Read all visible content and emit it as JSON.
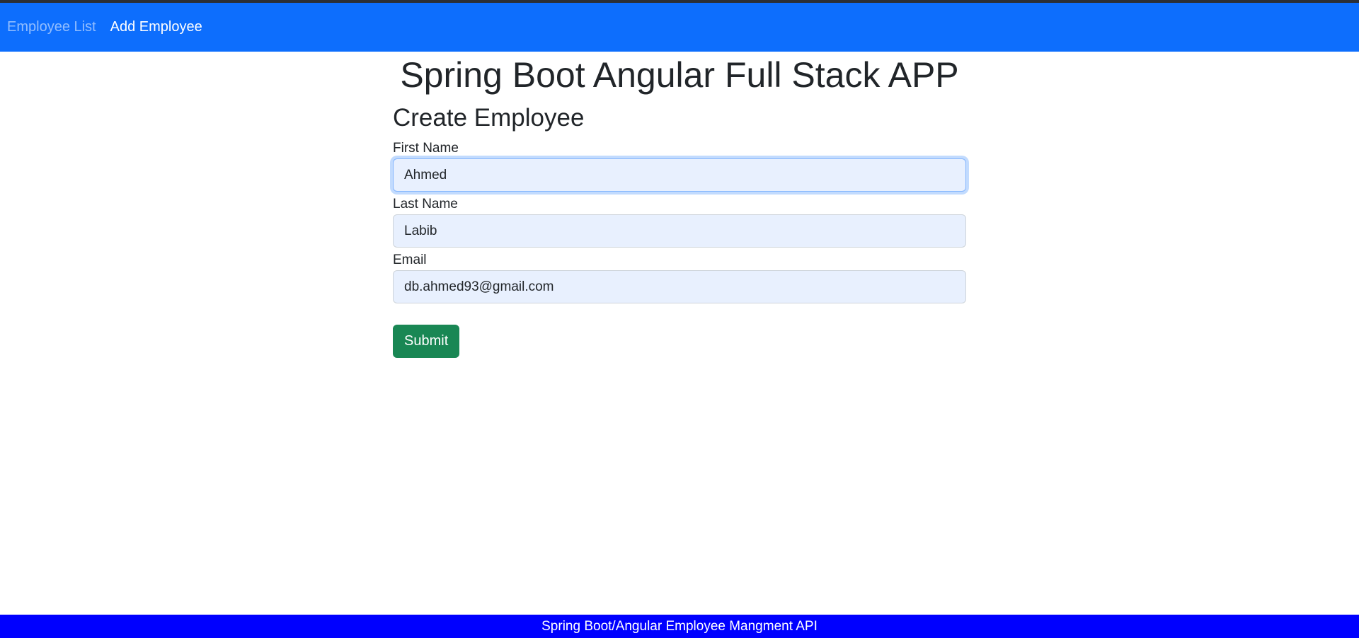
{
  "nav": {
    "items": [
      {
        "label": "Employee List"
      },
      {
        "label": "Add Employee"
      }
    ]
  },
  "app": {
    "title": "Spring Boot Angular Full Stack APP"
  },
  "form": {
    "title": "Create Employee",
    "fields": [
      {
        "label": "First Name",
        "value": "Ahmed"
      },
      {
        "label": "Last Name",
        "value": "Labib"
      },
      {
        "label": "Email",
        "value": "db.ahmed93@gmail.com"
      }
    ],
    "submit_label": "Submit"
  },
  "footer": {
    "text": "Spring Boot/Angular Employee Mangment API"
  },
  "colors": {
    "navbar": "#0d6efd",
    "footer": "#0000ff",
    "submit": "#198754",
    "input_bg": "#e8f0fe"
  }
}
